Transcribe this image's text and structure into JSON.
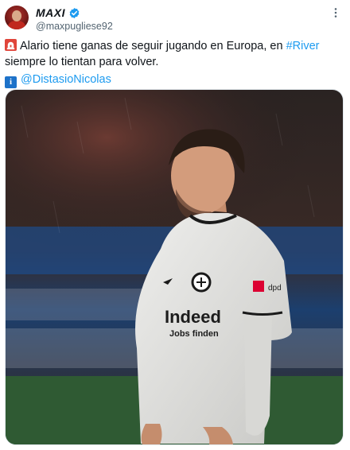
{
  "user": {
    "display_name": "MAXI",
    "handle": "@maxpugliese92",
    "avatar_icon": "avatar-photo",
    "verified": true
  },
  "menu": {
    "icon": "more-dots-icon"
  },
  "tweet": {
    "line1_pre": "Alario tiene ganas de seguir jugando en Europa, en ",
    "hashtag": "#River",
    "line1_post": " siempre lo tientan para volver.",
    "mention": "@DistasioNicolas"
  },
  "media": {
    "jersey_sponsor": "Indeed",
    "jersey_sub": "Jobs finden",
    "sleeve_logo": "dpd"
  },
  "colors": {
    "link": "#1d9bf0",
    "verified": "#1d9bf0",
    "handle": "#536471"
  }
}
